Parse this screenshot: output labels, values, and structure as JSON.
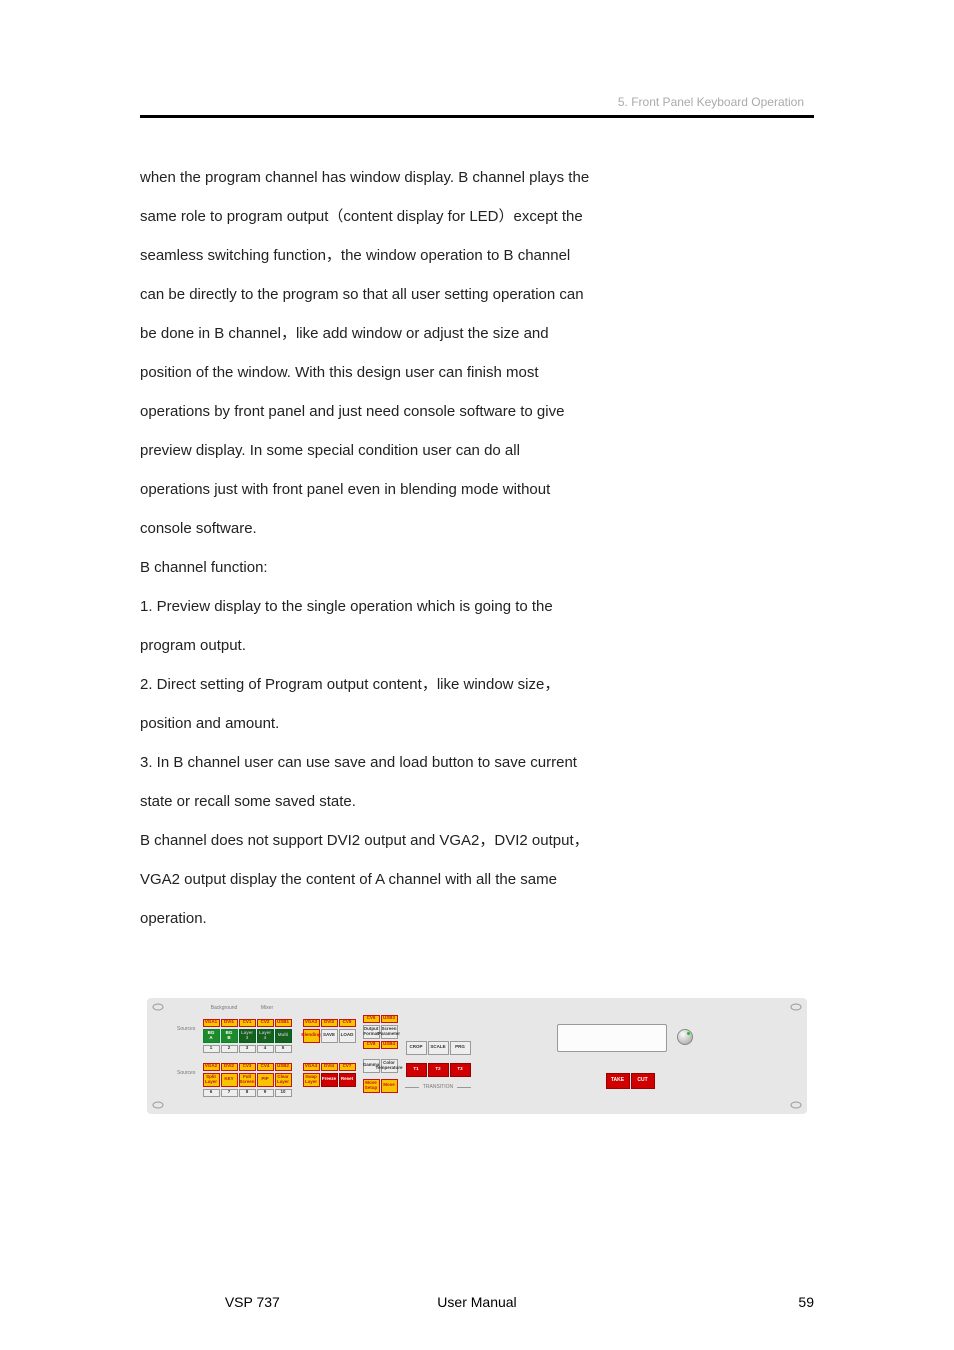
{
  "header": {
    "section": "5. Front Panel Keyboard Operation"
  },
  "body": {
    "p1": "when the program channel has window display. B channel plays the",
    "p2": "same role to program output（content display for LED）except the",
    "p3": "seamless switching function，the window operation to B channel",
    "p4": "can be directly to the program so that all user setting operation can",
    "p5": "be done in B channel，like add window or adjust the size and",
    "p6": "position of the window. With this design user can finish most",
    "p7": "operations by front panel and just need console software to give",
    "p8": "preview display. In some special condition user can do all",
    "p9": "operations just with front panel even in blending mode without",
    "p10": "console software.",
    "p11": "B channel function:",
    "p12": "1. Preview display to the single operation which is going to the",
    "p13": "program output.",
    "p14": "2. Direct setting of Program output content，like window size，",
    "p15": "position and amount.",
    "p16": "3. In B channel user can use save and load button to save current",
    "p17": "state or recall some saved state.",
    "p18": "B channel does not support DVI2 output and VGA2，DVI2 output，",
    "p19": "VGA2 output display the content of A channel with all the same",
    "p20": "operation."
  },
  "panel": {
    "group_background": "Background",
    "group_mixer": "Mixer",
    "group_transition": "TRANSITION",
    "sources_label": "Sources",
    "row1_sources": [
      "VGA1",
      "DVI1",
      "CV1",
      "CV2",
      "USB1"
    ],
    "row1_mixer": [
      "BG\\nA",
      "BG\\nB",
      "Layer\\n3",
      "Layer\\n4",
      "Multi"
    ],
    "row1_mixer_nums": [
      "1",
      "2",
      "3",
      "4",
      "5"
    ],
    "row2_sources": [
      "VGA2",
      "DVI2",
      "CV3",
      "CV4",
      "USB2"
    ],
    "row2_mixer": [
      "Split\\nLayer",
      "KEY",
      "Full\\nScreen",
      "PIP",
      "Clear\\nLayer"
    ],
    "row2_mixer_nums": [
      "6",
      "7",
      "8",
      "9",
      "10"
    ],
    "mid_top": [
      "VGA3",
      "DVI3",
      "CV5"
    ],
    "mid_a": [
      "Blending",
      "SAVE",
      "LOAD"
    ],
    "mid_bot": [
      "VGA4",
      "DVI4",
      "CV7"
    ],
    "mid_b": [
      "Swap\\nLayer",
      "Freeze",
      "Reset"
    ],
    "right_col1_top": [
      "CV6",
      "USB3"
    ],
    "right_col1_a": [
      "Output\\nFormat",
      "Screen\\nParameter"
    ],
    "right_col1_mid": [
      "CV8",
      "USB4"
    ],
    "right_col1_b": [
      "Gamma",
      "Color\\nTemperature"
    ],
    "right_col1_bot": [
      "Move\\nSetup",
      "Move"
    ],
    "right_col2_top": [
      "CROP",
      "SCALE",
      "PRG"
    ],
    "right_col2_bot": [
      "T1",
      "T2",
      "T3"
    ],
    "take_cut": [
      "TAKE",
      "CUT"
    ]
  },
  "footer": {
    "left": "VSP 737",
    "center": "User Manual",
    "right": "59"
  }
}
